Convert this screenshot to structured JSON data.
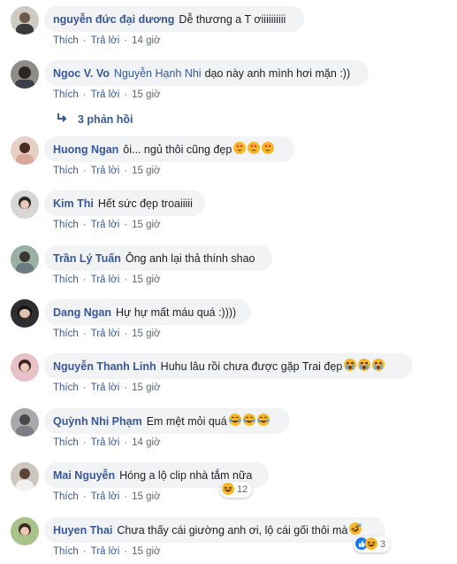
{
  "actions": {
    "like": "Thích",
    "reply": "Trả lời"
  },
  "comments": [
    {
      "author": "nguyễn đức đại dương",
      "mention": "",
      "text": "Dễ thương a T ơiiiiiiiiii",
      "time": "14 giờ"
    },
    {
      "author": "Ngoc V. Vo",
      "mention": "Nguyễn Hạnh Nhi",
      "text": "dạo này anh mình hơi mặn :))",
      "time": "15 giờ"
    },
    {
      "author": "Huong Ngan",
      "mention": "",
      "text": "ôi... ngủ thôi cũng đẹp",
      "time": "15 giờ",
      "emojis": [
        "heart-eyes",
        "heart-eyes",
        "heart-eyes"
      ]
    },
    {
      "author": "Kim Thi",
      "mention": "",
      "text": "Hết sức đẹp troaiiiii",
      "time": "15 giờ"
    },
    {
      "author": "Trần Lý Tuấn",
      "mention": "",
      "text": "Ông anh lại thả thính shao",
      "time": "15 giờ"
    },
    {
      "author": "Dang Ngan",
      "mention": "",
      "text": "Hự hự mất máu quá :))))",
      "time": "15 giờ"
    },
    {
      "author": "Nguyễn Thanh Linh",
      "mention": "",
      "text": "Huhu lâu rồi chưa được gặp Trai đẹp",
      "time": "15 giờ",
      "emojis": [
        "crying",
        "crying",
        "crying"
      ]
    },
    {
      "author": "Quỳnh Nhi Phạm",
      "mention": "",
      "text": "Em mệt mỏi quá",
      "time": "14 giờ",
      "emojis": [
        "tears-of-joy",
        "tears-of-joy",
        "tears-of-joy"
      ]
    },
    {
      "author": "Mai Nguyễn",
      "mention": "",
      "text": "Hóng a lộ clip nhà tắm nữa",
      "time": "15 giờ",
      "reaction_count": "12",
      "reaction_icon": "haha-icon"
    },
    {
      "author": "Huyen Thai",
      "mention": "",
      "text": "Chưa thấy cái giường anh ơi, lộ cái gối thôi mà",
      "time": "15 giờ",
      "emojis": [
        "rofl"
      ],
      "reaction_count": "3",
      "reaction_icon": "like-haha-icons"
    }
  ],
  "replies_link": "3 phản hồi",
  "colors": {
    "link": "#385898",
    "bubble": "#f2f3f5",
    "meta": "#606770"
  }
}
